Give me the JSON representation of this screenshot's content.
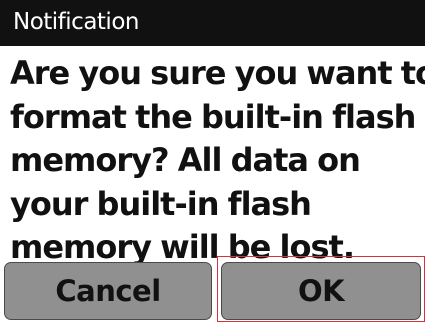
{
  "dialog": {
    "title": "Notification",
    "message_lines": [
      "Are you sure you want to",
      "format the built-in flash",
      "memory? All data on",
      "your built-in flash",
      "memory will be lost."
    ],
    "buttons": {
      "cancel_label": "Cancel",
      "ok_label": "OK"
    },
    "focused_button": "OK"
  },
  "colors": {
    "titlebar_bg": "#111111",
    "button_bg": "#909090",
    "focus_ring": "#d9303a"
  }
}
